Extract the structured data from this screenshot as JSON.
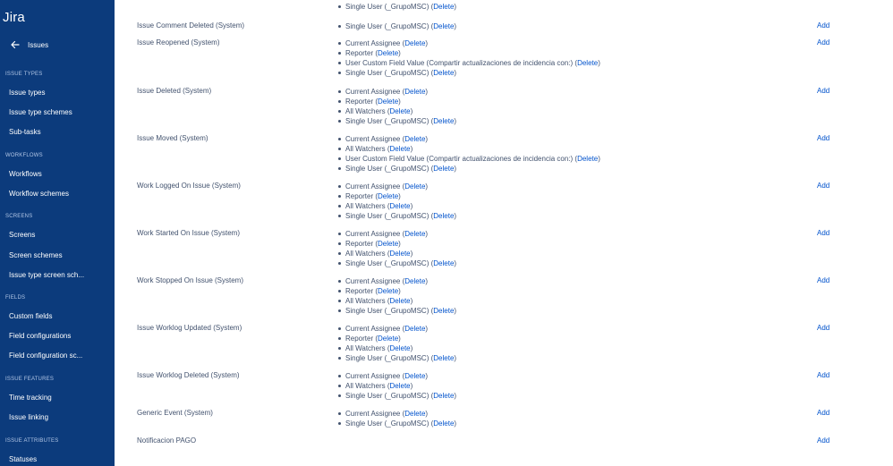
{
  "sidebar": {
    "logo": "Jira",
    "back_label": "Issues",
    "sections": [
      {
        "heading": "ISSUE TYPES",
        "items": [
          "Issue types",
          "Issue type schemes",
          "Sub-tasks"
        ]
      },
      {
        "heading": "WORKFLOWS",
        "items": [
          "Workflows",
          "Workflow schemes"
        ]
      },
      {
        "heading": "SCREENS",
        "items": [
          "Screens",
          "Screen schemes",
          "Issue type screen sch..."
        ]
      },
      {
        "heading": "FIELDS",
        "items": [
          "Custom fields",
          "Field configurations",
          "Field configuration sc..."
        ]
      },
      {
        "heading": "ISSUE FEATURES",
        "items": [
          "Time tracking",
          "Issue linking"
        ]
      },
      {
        "heading": "ISSUE ATTRIBUTES",
        "items": [
          "Statuses"
        ]
      }
    ]
  },
  "labels": {
    "delete": "Delete",
    "add": "Add"
  },
  "events": [
    {
      "name": "",
      "add": false,
      "recipients": [
        "Single User (_GrupoMSC)"
      ]
    },
    {
      "name": "Issue Comment Deleted (System)",
      "add": true,
      "recipients": [
        "Single User (_GrupoMSC)"
      ]
    },
    {
      "name": "Issue Reopened (System)",
      "add": true,
      "recipients": [
        "Current Assignee",
        "Reporter",
        "User Custom Field Value (Compartir actualizaciones de incidencia con:)",
        "Single User (_GrupoMSC)"
      ]
    },
    {
      "name": "Issue Deleted (System)",
      "add": true,
      "recipients": [
        "Current Assignee",
        "Reporter",
        "All Watchers",
        "Single User (_GrupoMSC)"
      ]
    },
    {
      "name": "Issue Moved (System)",
      "add": true,
      "recipients": [
        "Current Assignee",
        "All Watchers",
        "User Custom Field Value (Compartir actualizaciones de incidencia con:)",
        "Single User (_GrupoMSC)"
      ]
    },
    {
      "name": "Work Logged On Issue (System)",
      "add": true,
      "recipients": [
        "Current Assignee",
        "Reporter",
        "All Watchers",
        "Single User (_GrupoMSC)"
      ]
    },
    {
      "name": "Work Started On Issue (System)",
      "add": true,
      "recipients": [
        "Current Assignee",
        "Reporter",
        "All Watchers",
        "Single User (_GrupoMSC)"
      ]
    },
    {
      "name": "Work Stopped On Issue (System)",
      "add": true,
      "recipients": [
        "Current Assignee",
        "Reporter",
        "All Watchers",
        "Single User (_GrupoMSC)"
      ]
    },
    {
      "name": "Issue Worklog Updated (System)",
      "add": true,
      "recipients": [
        "Current Assignee",
        "Reporter",
        "All Watchers",
        "Single User (_GrupoMSC)"
      ]
    },
    {
      "name": "Issue Worklog Deleted (System)",
      "add": true,
      "recipients": [
        "Current Assignee",
        "All Watchers",
        "Single User (_GrupoMSC)"
      ]
    },
    {
      "name": "Generic Event (System)",
      "add": true,
      "recipients": [
        "Current Assignee",
        "Single User (_GrupoMSC)"
      ]
    },
    {
      "name": "Notificacion PAGO",
      "add": true,
      "recipients": []
    }
  ]
}
